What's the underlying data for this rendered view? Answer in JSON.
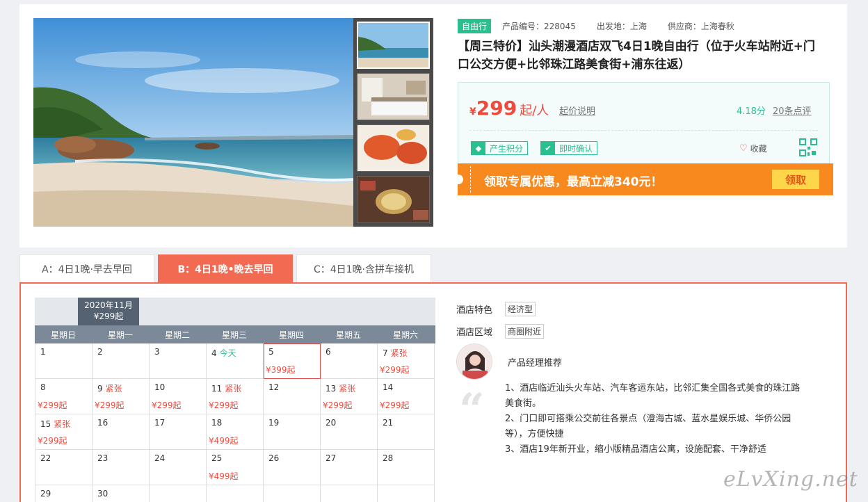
{
  "product": {
    "type_tag": "自由行",
    "code": "产品编号：228045",
    "departure": "出发地：上海",
    "supplier": "供应商：上海春秋",
    "title": "【周三特价】汕头潮漫酒店双飞4日1晚自由行（位于火车站附近+门口公交方便+比邻珠江路美食街+浦东往返）"
  },
  "price": {
    "currency": "¥",
    "amount": "299",
    "unit": "起/人",
    "note": "起价说明",
    "score": "4.18分",
    "reviews": "20条点评"
  },
  "badges": [
    "产生积分",
    "即时确认"
  ],
  "favorite": "收藏",
  "promo": {
    "text": "领取专属优惠，最高立减340元！",
    "button": "领取"
  },
  "tabs": [
    "A：4日1晚·早去早回",
    "B：4日1晚•晚去早回",
    "C：4日1晚·含拼车接机"
  ],
  "calendar": {
    "month": "2020年11月",
    "month_price": "¥299起",
    "weekdays": [
      "星期日",
      "星期一",
      "星期二",
      "星期三",
      "星期四",
      "星期五",
      "星期六"
    ],
    "rows": [
      [
        {
          "d": "1",
          "s": "",
          "p": ""
        },
        {
          "d": "2",
          "s": "",
          "p": ""
        },
        {
          "d": "3",
          "s": "",
          "p": ""
        },
        {
          "d": "4",
          "s": "今天",
          "p": ""
        },
        {
          "d": "5",
          "s": "",
          "p": "¥399起"
        },
        {
          "d": "6",
          "s": "",
          "p": ""
        },
        {
          "d": "7",
          "s": "紧张",
          "p": "¥299起"
        }
      ],
      [
        {
          "d": "8",
          "s": "",
          "p": "¥299起"
        },
        {
          "d": "9",
          "s": "紧张",
          "p": "¥299起"
        },
        {
          "d": "10",
          "s": "",
          "p": "¥299起"
        },
        {
          "d": "11",
          "s": "紧张",
          "p": "¥299起"
        },
        {
          "d": "12",
          "s": "",
          "p": ""
        },
        {
          "d": "13",
          "s": "紧张",
          "p": "¥299起"
        },
        {
          "d": "14",
          "s": "",
          "p": "¥299起"
        }
      ],
      [
        {
          "d": "15",
          "s": "紧张",
          "p": "¥299起"
        },
        {
          "d": "16",
          "s": "",
          "p": ""
        },
        {
          "d": "17",
          "s": "",
          "p": ""
        },
        {
          "d": "18",
          "s": "",
          "p": "¥499起"
        },
        {
          "d": "19",
          "s": "",
          "p": ""
        },
        {
          "d": "20",
          "s": "",
          "p": ""
        },
        {
          "d": "21",
          "s": "",
          "p": ""
        }
      ],
      [
        {
          "d": "22",
          "s": "",
          "p": ""
        },
        {
          "d": "23",
          "s": "",
          "p": ""
        },
        {
          "d": "24",
          "s": "",
          "p": ""
        },
        {
          "d": "25",
          "s": "",
          "p": "¥499起"
        },
        {
          "d": "26",
          "s": "",
          "p": ""
        },
        {
          "d": "27",
          "s": "",
          "p": ""
        },
        {
          "d": "28",
          "s": "",
          "p": ""
        }
      ],
      [
        {
          "d": "29",
          "s": "",
          "p": ""
        },
        {
          "d": "30",
          "s": "",
          "p": ""
        },
        {
          "d": "",
          "s": "",
          "p": ""
        },
        {
          "d": "",
          "s": "",
          "p": ""
        },
        {
          "d": "",
          "s": "",
          "p": ""
        },
        {
          "d": "",
          "s": "",
          "p": ""
        },
        {
          "d": "",
          "s": "",
          "p": ""
        }
      ]
    ]
  },
  "hotel": {
    "feature_label": "酒店特色",
    "feature_value": "经济型",
    "area_label": "酒店区域",
    "area_value": "商圈附近",
    "manager_label": "产品经理推荐",
    "points": [
      "1、酒店临近汕头火车站、汽车客运东站，比邻汇集全国各式美食的珠江路美食街。",
      "2、门口即可搭乘公交前往各景点（澄海古城、蓝水星娱乐城、华侨公园等），方便快捷",
      "3、酒店19年新开业，缩小版精品酒店公寓，设施配套、干净舒适"
    ]
  },
  "watermark": "eLvXing.net",
  "colors": {
    "accent": "#f16a51",
    "green": "#2bbf8f",
    "price_red": "#f04a3c",
    "promo_orange": "#f7891f"
  }
}
